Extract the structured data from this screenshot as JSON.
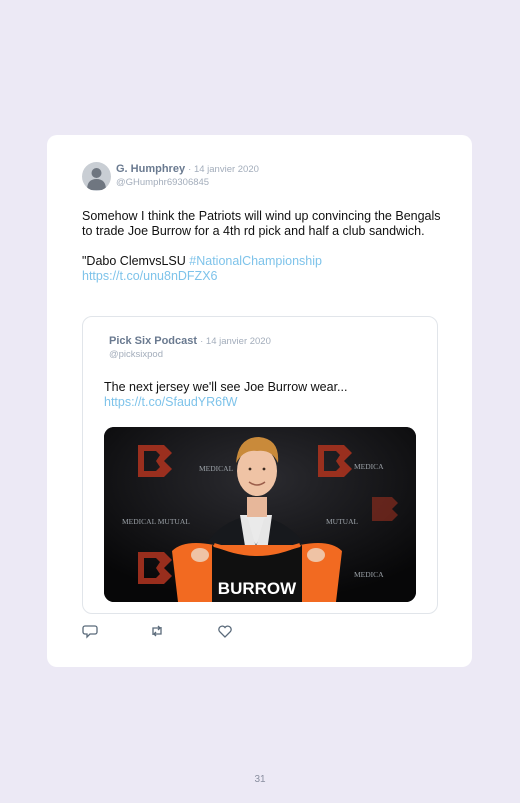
{
  "tweet": {
    "author_name": "G. Humphrey",
    "date": "· 14 janvier 2020",
    "handle": "@GHumphr69306845",
    "text_line1": "Somehow I think the Patriots will wind up convincing the Bengals to trade Joe Burrow for a 4th rd pick and half a club sandwich.",
    "text_line2_prefix": "\"Dabo ClemvsLSU ",
    "hashtag": "#NationalChampionship",
    "link": "https://t.co/unu8nDFZX6"
  },
  "quoted": {
    "author_name": "Pick Six Podcast",
    "date": "· 14 janvier 2020",
    "handle": "@picksixpod",
    "text": "The next jersey we'll see Joe Burrow wear...",
    "link": "https://t.co/SfaudYR6fW",
    "photo": {
      "jersey_name": "BURROW",
      "backdrop_sponsor": "MEDICAL MUTUAL"
    }
  },
  "actions": {
    "reply_icon": "reply-icon",
    "retweet_icon": "retweet-icon",
    "like_icon": "heart-icon"
  },
  "page_number": "31",
  "colors": {
    "background": "#ece9f5",
    "link_blue": "#7ec3ea",
    "name_gray": "#6a7a90",
    "meta_gray": "#a3adbb",
    "jersey_orange": "#f26a21"
  }
}
